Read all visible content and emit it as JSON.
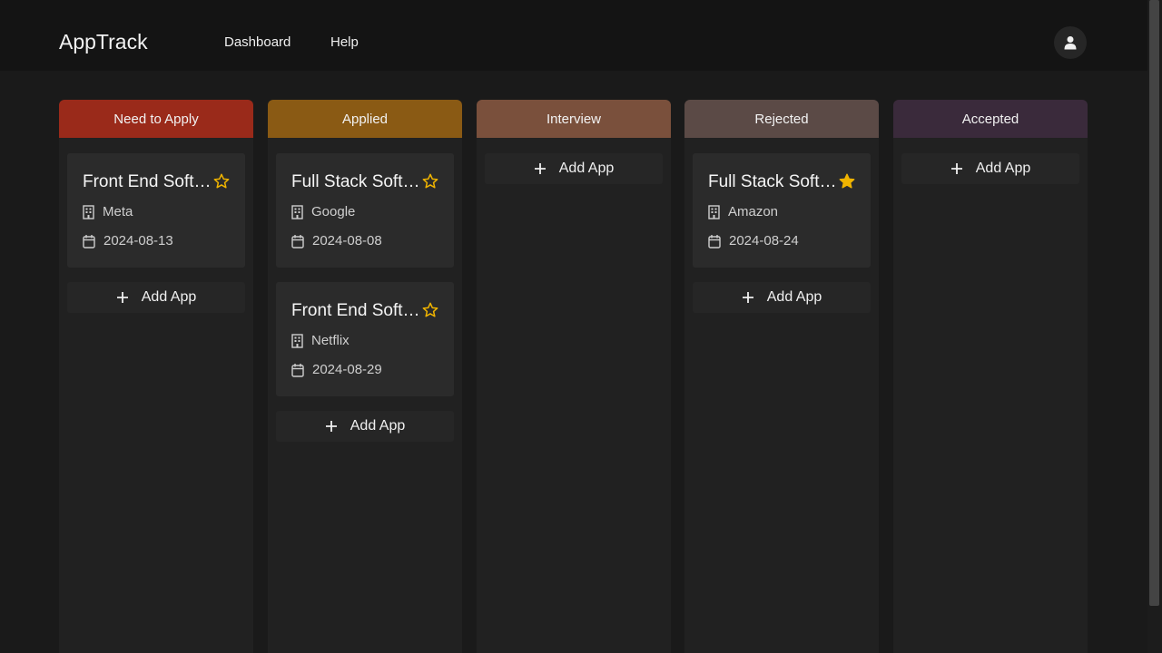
{
  "app": {
    "brand": "AppTrack"
  },
  "nav": {
    "dashboard": "Dashboard",
    "help": "Help"
  },
  "colors": {
    "need_to_apply": "#9a2a1a",
    "applied": "#8a5a14",
    "interview": "#7a503c",
    "rejected": "#5b4a46",
    "accepted": "#3a2a3b",
    "star": "#f0b400"
  },
  "add_label": "Add App",
  "columns": [
    {
      "title": "Need to Apply",
      "cards": [
        {
          "title": "Front End Software Engineer",
          "company": "Meta",
          "date": "2024-08-13",
          "starred": false
        }
      ]
    },
    {
      "title": "Applied",
      "cards": [
        {
          "title": "Full Stack Software Engineer",
          "company": "Google",
          "date": "2024-08-08",
          "starred": false
        },
        {
          "title": "Front End Software Engineer",
          "company": "Netflix",
          "date": "2024-08-29",
          "starred": false
        }
      ]
    },
    {
      "title": "Interview",
      "cards": []
    },
    {
      "title": "Rejected",
      "cards": [
        {
          "title": "Full Stack Software Engineer",
          "company": "Amazon",
          "date": "2024-08-24",
          "starred": true
        }
      ]
    },
    {
      "title": "Accepted",
      "cards": []
    }
  ]
}
